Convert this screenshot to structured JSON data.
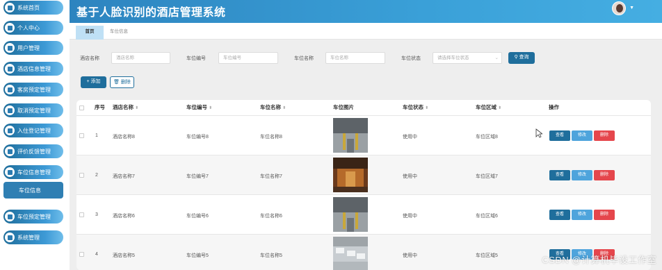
{
  "header": {
    "title": "基于人脸识别的酒店管理系统"
  },
  "sidebar": {
    "items": [
      {
        "label": "系统首页",
        "icon": "home-icon"
      },
      {
        "label": "个人中心",
        "icon": "profile-icon"
      },
      {
        "label": "用户管理",
        "icon": "user-icon"
      },
      {
        "label": "酒店信息管理",
        "icon": "grid-icon"
      },
      {
        "label": "客房预定管理",
        "icon": "monitor-icon"
      },
      {
        "label": "取消预定管理",
        "icon": "grid-icon"
      },
      {
        "label": "入住登记管理",
        "icon": "grid-icon"
      },
      {
        "label": "评价反馈管理",
        "icon": "list-icon"
      },
      {
        "label": "车位信息管理",
        "icon": "send-icon"
      },
      {
        "label": "车位信息",
        "sub": true
      },
      {
        "label": "车位预定管理",
        "icon": "grid-icon"
      },
      {
        "label": "系统管理",
        "icon": "grid-icon"
      }
    ]
  },
  "tabs": [
    {
      "label": "首页"
    },
    {
      "label": "车位信息"
    }
  ],
  "filters": {
    "hotel_name": {
      "label": "酒店名称",
      "placeholder": "酒店名称"
    },
    "space_no": {
      "label": "车位编号",
      "placeholder": "车位编号"
    },
    "space_name": {
      "label": "车位名称",
      "placeholder": "车位名称"
    },
    "space_status": {
      "label": "车位状态",
      "placeholder": "请选择车位状态"
    },
    "search_label": "查询"
  },
  "actions": {
    "add": "添加",
    "delete": "删除"
  },
  "table": {
    "columns": [
      "序号",
      "酒店名称",
      "车位编号",
      "车位名称",
      "车位图片",
      "车位状态",
      "车位区域",
      "操作"
    ],
    "row_buttons": {
      "view": "查看",
      "edit": "修改",
      "delete": "删除"
    },
    "rows": [
      {
        "no": "1",
        "hotel": "酒店名称8",
        "code": "车位编号8",
        "name": "车位名称8",
        "status": "使用中",
        "area": "车位区域8"
      },
      {
        "no": "2",
        "hotel": "酒店名称7",
        "code": "车位编号7",
        "name": "车位名称7",
        "status": "使用中",
        "area": "车位区域7"
      },
      {
        "no": "3",
        "hotel": "酒店名称6",
        "code": "车位编号6",
        "name": "车位名称6",
        "status": "使用中",
        "area": "车位区域6"
      },
      {
        "no": "4",
        "hotel": "酒店名称5",
        "code": "车位编号5",
        "name": "车位名称5",
        "status": "使用中",
        "area": "车位区域5"
      }
    ]
  },
  "watermark": "CSDN @计算机毕设工作室"
}
